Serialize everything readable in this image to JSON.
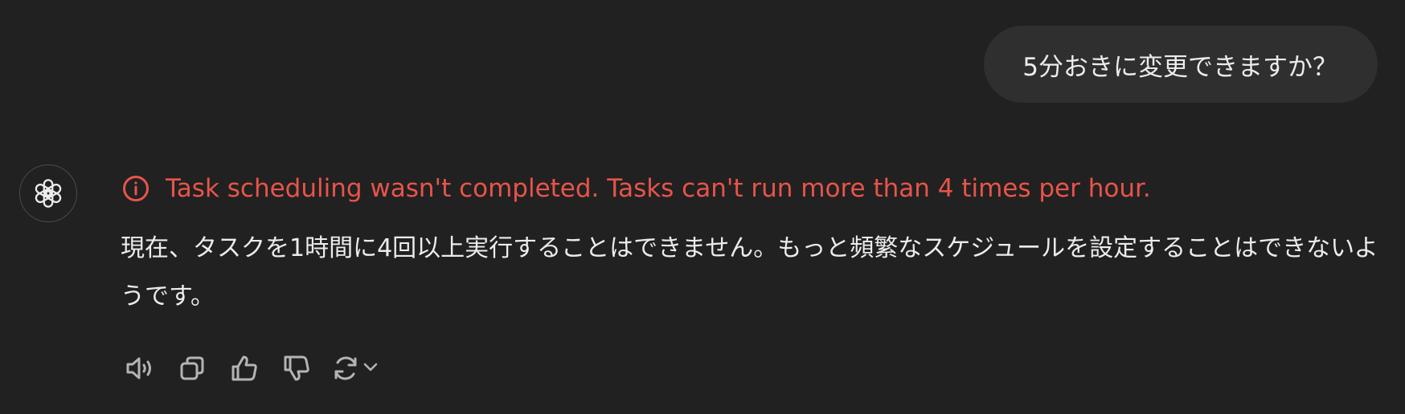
{
  "conversation": {
    "user_message": "5分おきに変更できますか？",
    "assistant": {
      "avatar_icon": "openai-logo-icon",
      "error_icon": "info-circle-icon",
      "error_text": "Task scheduling wasn't completed. Tasks can't run more than 4 times per hour.",
      "error_color": "#e8544a",
      "body_text": "現在、タスクを1時間に4回以上実行することはできません。もっと頻繁なスケジュールを設定することはできないようです。"
    },
    "actions": [
      {
        "icon": "speaker-icon"
      },
      {
        "icon": "copy-icon"
      },
      {
        "icon": "thumbs-up-icon"
      },
      {
        "icon": "thumbs-down-icon"
      },
      {
        "icon": "regenerate-icon"
      },
      {
        "icon": "chevron-down-icon"
      }
    ]
  },
  "colors": {
    "background": "#212121",
    "user_bubble": "#2f2f2f",
    "text": "#ececec",
    "icon": "#b4b4b4"
  }
}
